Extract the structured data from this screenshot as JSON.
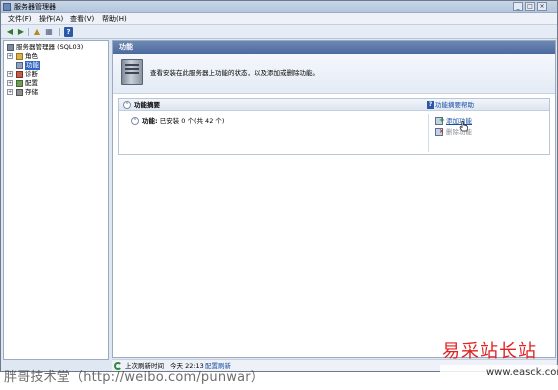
{
  "window": {
    "title": "服务器管理器",
    "buttons": [
      "_",
      "□",
      "×"
    ]
  },
  "menu": {
    "file": "文件(F)",
    "action": "操作(A)",
    "view": "查看(V)",
    "help": "帮助(H)"
  },
  "toolbar": {
    "icons": [
      "back-arrow-icon",
      "forward-arrow-icon",
      "up-folder-icon",
      "show-hide-tree-icon",
      "help-icon"
    ],
    "help_glyph": "?"
  },
  "tree": {
    "root": "服务器管理器 (SQL03)",
    "items": [
      {
        "label": "角色",
        "expander": "+"
      },
      {
        "label": "功能",
        "expander": "",
        "selected": true
      },
      {
        "label": "诊断",
        "expander": "+"
      },
      {
        "label": "配置",
        "expander": "+"
      },
      {
        "label": "存储",
        "expander": "+"
      }
    ]
  },
  "content": {
    "header": "功能",
    "description": "查看安装在此服务器上功能的状态，以及添加或删除功能。",
    "summary": {
      "title": "功能摘要",
      "help_link": "功能摘要帮助",
      "help_glyph": "?",
      "installed_label": "功能:",
      "installed_value": "已安装 0 个(共 42 个)",
      "actions": {
        "add": "添加功能",
        "remove": "删除功能"
      }
    }
  },
  "statusbar": {
    "last_refresh_label": "上次刷新时间",
    "last_refresh_value": "今天 22:13",
    "refresh_link": "配置刷新"
  },
  "watermarks": {
    "left": "胖哥技术堂（http://weibo.com/punwar）",
    "right_big": "易采站长站",
    "right_small": "www.easck.com"
  },
  "colors": {
    "header_blue": "#4c6a9e",
    "link_blue": "#1b4ea3",
    "selection_blue": "#3367c2",
    "watermark_red": "#e02222"
  }
}
